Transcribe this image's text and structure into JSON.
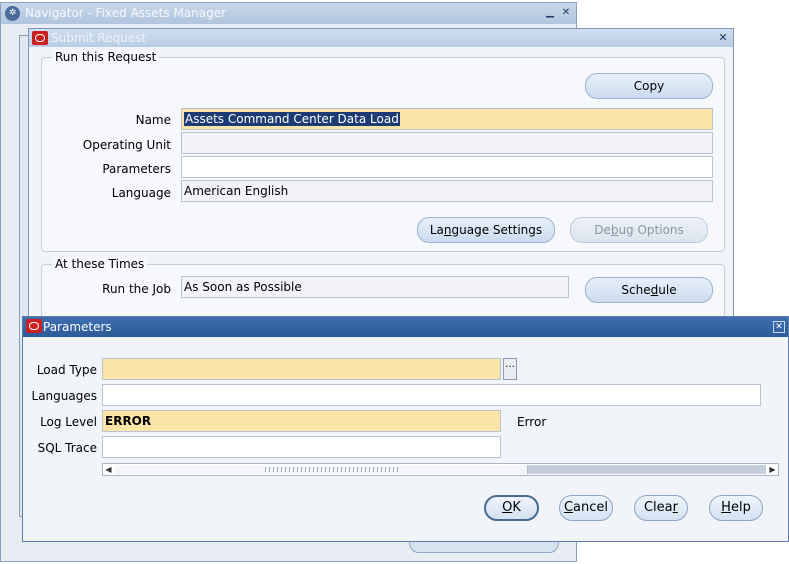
{
  "navigator": {
    "title": "Navigator - Fixed Assets Manager",
    "minimize_glyph": "▁",
    "close_glyph": "✕"
  },
  "submit_request": {
    "title": "Submit Request",
    "close_glyph": "✕",
    "run_group_label": "Run this Request",
    "copy_button": "Copy",
    "name_label": "Name",
    "name_value": "Assets Command Center Data Load",
    "operating_unit_label": "Operating Unit",
    "operating_unit_value": "",
    "parameters_label": "Parameters",
    "parameters_value": "",
    "language_label": "Language",
    "language_value": "American English",
    "language_settings_button": {
      "pre": "La",
      "u": "n",
      "post": "guage Settings"
    },
    "debug_options_button": {
      "pre": "De",
      "u": "b",
      "post": "ug Options"
    },
    "times_group_label": "At these Times",
    "run_job_label": "Run the Job",
    "run_job_value": "As Soon as Possible",
    "schedule_button": {
      "pre": "Sche",
      "u": "d",
      "post": "ule"
    }
  },
  "parameters": {
    "title": "Parameters",
    "close_glyph": "✕",
    "load_type_label": "Load Type",
    "load_type_value": "",
    "lov_glyph": "···",
    "languages_label": "Languages",
    "languages_value": "",
    "log_level_label": "Log Level",
    "log_level_value": "ERROR",
    "log_level_description": "Error",
    "sql_trace_label": "SQL Trace",
    "sql_trace_value": "",
    "scroll_left_glyph": "◀",
    "scroll_right_glyph": "▶",
    "ok_button": {
      "pre": "",
      "u": "O",
      "post": "K"
    },
    "cancel_button": {
      "pre": "",
      "u": "C",
      "post": "ancel"
    },
    "clear_button": {
      "pre": "Clea",
      "u": "r",
      "post": ""
    },
    "help_button": {
      "pre": "",
      "u": "H",
      "post": "elp"
    }
  }
}
